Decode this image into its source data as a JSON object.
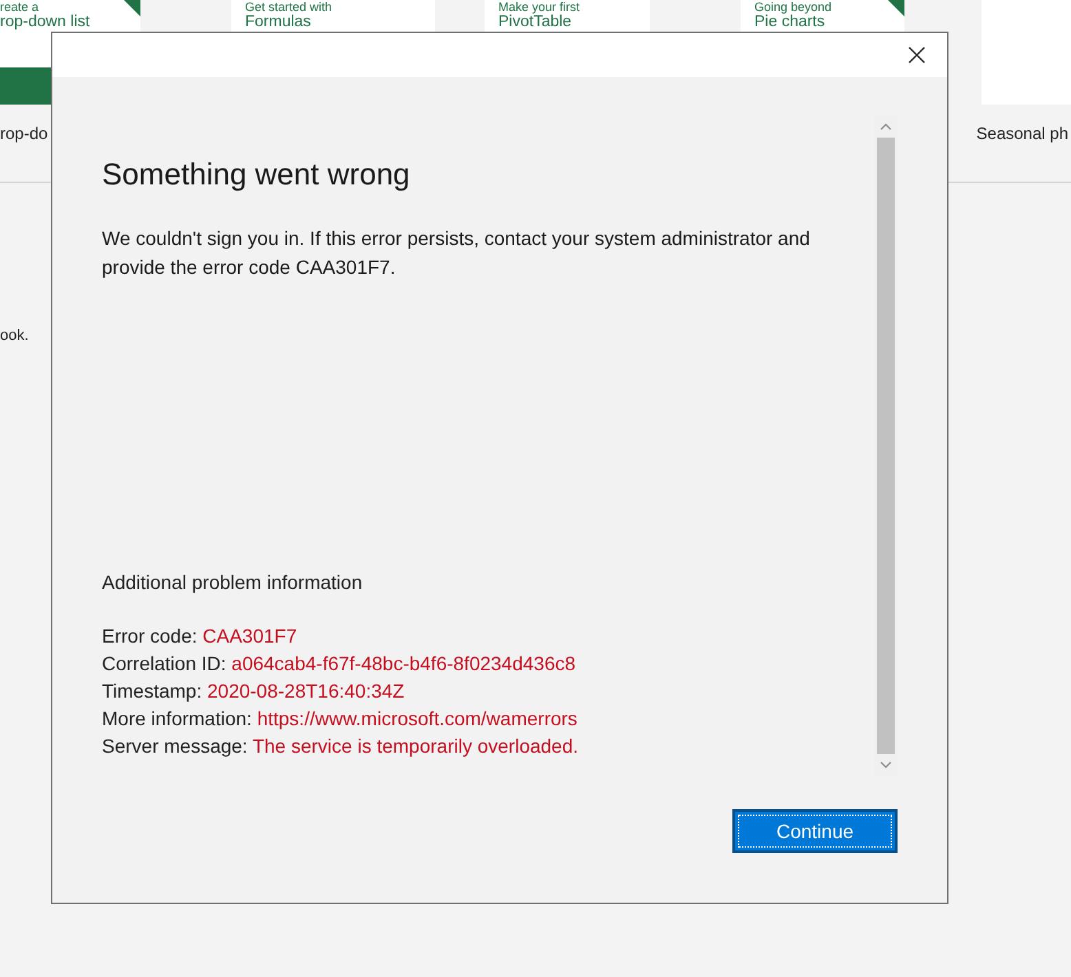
{
  "background": {
    "tiles": [
      {
        "kicker": "reate a",
        "title": "rop-down list",
        "flagged": true,
        "band": true
      },
      {
        "kicker": "Get started with",
        "title": "Formulas",
        "flagged": false
      },
      {
        "kicker": "Make your first",
        "title": "PivotTable",
        "flagged": false
      },
      {
        "kicker": "Going beyond",
        "title": "Pie charts",
        "flagged": true
      },
      {
        "flagged": false
      }
    ],
    "captions": [
      "rop-do",
      "Seasonal ph"
    ],
    "description": "ook."
  },
  "dialog": {
    "title": "Something went wrong",
    "message": "We couldn't sign you in. If this error persists, contact your system administrator and provide the error code CAA301F7.",
    "details_heading": "Additional problem information",
    "details": [
      {
        "label": "Error code:",
        "value": "CAA301F7"
      },
      {
        "label": "Correlation ID:",
        "value": "a064cab4-f67f-48bc-b4f6-8f0234d436c8"
      },
      {
        "label": "Timestamp:",
        "value": "2020-08-28T16:40:34Z"
      },
      {
        "label": "More information:",
        "value": "https://www.microsoft.com/wamerrors"
      },
      {
        "label": "Server message:",
        "value": "The service is temporarily overloaded."
      }
    ],
    "button": "Continue"
  }
}
